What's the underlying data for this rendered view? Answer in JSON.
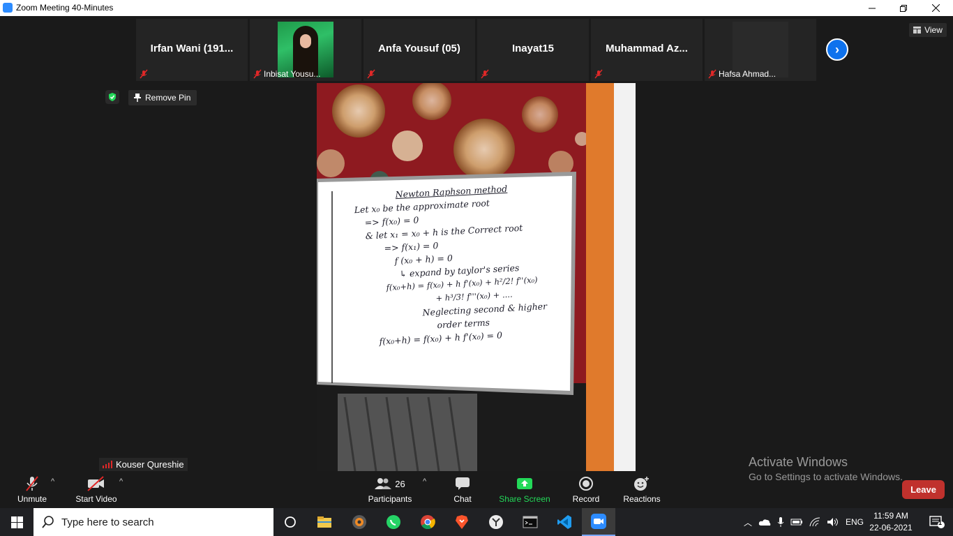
{
  "window": {
    "title": "Zoom Meeting 40-Minutes",
    "minimize_icon": "minimize-icon",
    "maximize_icon": "restore-icon",
    "close_icon": "close-icon"
  },
  "gallery": {
    "tiles": [
      {
        "display_name": "Irfan Wani (191...",
        "has_video": false
      },
      {
        "display_name": "Inbisat Yousu...",
        "has_video": true
      },
      {
        "display_name": "Anfa Yousuf (05)",
        "has_video": false
      },
      {
        "display_name": "Inayat15",
        "has_video": false
      },
      {
        "display_name": "Muhammad  Az...",
        "has_video": false
      },
      {
        "display_name": "Hafsa Ahmad...",
        "has_video": false
      }
    ],
    "next_page_icon": "chevron-right-icon",
    "view_label": "View"
  },
  "pin": {
    "label": "Remove Pin"
  },
  "active_speaker": {
    "name": "Kouser Qureshie"
  },
  "whiteboard": {
    "lines": [
      "Newton Raphson method",
      "Let x₀ be the approximate root",
      "=> f(x₀) = 0",
      "& let x₁ = x₀ + h is the Correct root",
      "=> f(x₁) = 0",
      "f (x₀ + h) = 0",
      "↳ expand by taylor's series",
      "f(x₀+h) = f(x₀) + h f'(x₀) + h²/2! f''(x₀)",
      "+ h³/3! f'''(x₀) + ....",
      "Neglecting second & higher",
      "order terms",
      "f(x₀+h) = f(x₀) + h f'(x₀) = 0"
    ]
  },
  "toolbar": {
    "unmute": "Unmute",
    "start_video": "Start Video",
    "participants": "Participants",
    "participants_count": "26",
    "chat": "Chat",
    "share_screen": "Share Screen",
    "record": "Record",
    "reactions": "Reactions",
    "leave": "Leave",
    "share_color": "#23d959",
    "leave_color": "#c0312d"
  },
  "watermark": {
    "line1": "Activate Windows",
    "line2": "Go to Settings to activate Windows."
  },
  "taskbar": {
    "search_placeholder": "Type here to search",
    "apps": [
      "task-view-icon",
      "file-explorer-icon",
      "media-app-icon",
      "whatsapp-icon",
      "chrome-icon",
      "brave-icon",
      "yandex-icon",
      "terminal-icon",
      "vscode-icon",
      "zoom-icon"
    ],
    "language": "ENG",
    "time": "11:59 AM",
    "date": "22-06-2021",
    "notification_count": "1"
  }
}
